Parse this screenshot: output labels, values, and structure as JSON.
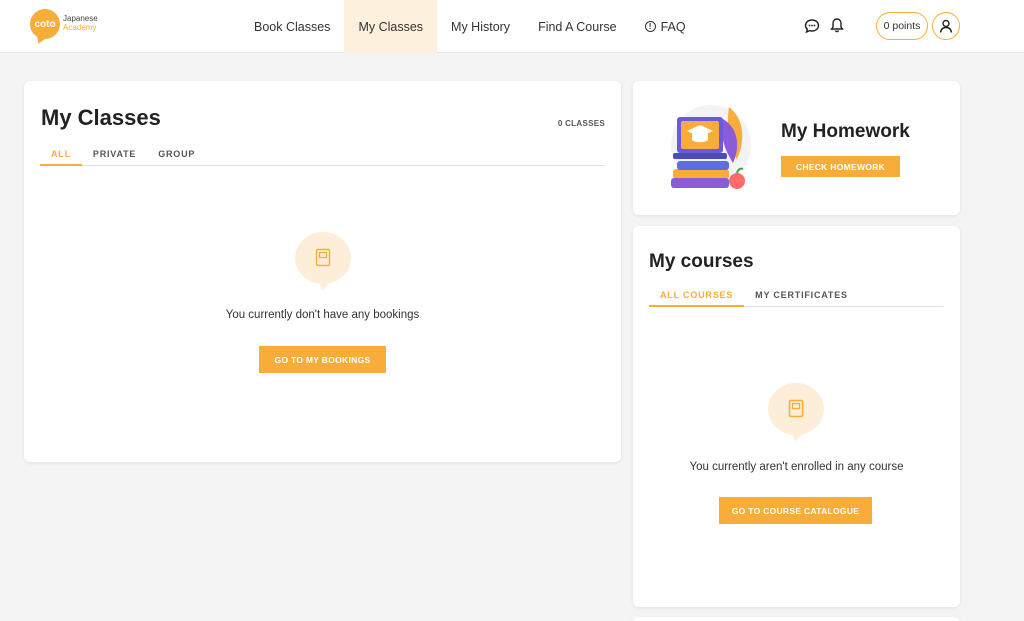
{
  "logo": {
    "mark": "coto",
    "line1": "Japanese",
    "line2": "Academy"
  },
  "nav": {
    "items": [
      {
        "label": "Book Classes"
      },
      {
        "label": "My Classes"
      },
      {
        "label": "My History"
      },
      {
        "label": "Find A Course"
      },
      {
        "label": "FAQ"
      }
    ],
    "active_index": 1
  },
  "header": {
    "points": "0 points"
  },
  "my_classes": {
    "title": "My Classes",
    "count": "0 CLASSES",
    "tabs": [
      "ALL",
      "PRIVATE",
      "GROUP"
    ],
    "active_tab": 0,
    "empty_text": "You currently don't have any bookings",
    "button": "GO TO MY BOOKINGS"
  },
  "homework": {
    "title": "My Homework",
    "button": "CHECK HOMEWORK"
  },
  "courses": {
    "title": "My courses",
    "tabs": [
      "ALL COURSES",
      "MY CERTIFICATES"
    ],
    "active_tab": 0,
    "empty_text": "You currently aren't enrolled in any course",
    "button": "GO TO COURSE CATALOGUE"
  },
  "colors": {
    "accent": "#f8ac3a",
    "accent_light": "#fdeed9",
    "nav_active_bg": "#fdf0dc",
    "page_bg": "#f4f4f4"
  },
  "icons": [
    "chat-bubble-icon",
    "bell-icon",
    "user-icon",
    "book-icon",
    "info-icon"
  ]
}
